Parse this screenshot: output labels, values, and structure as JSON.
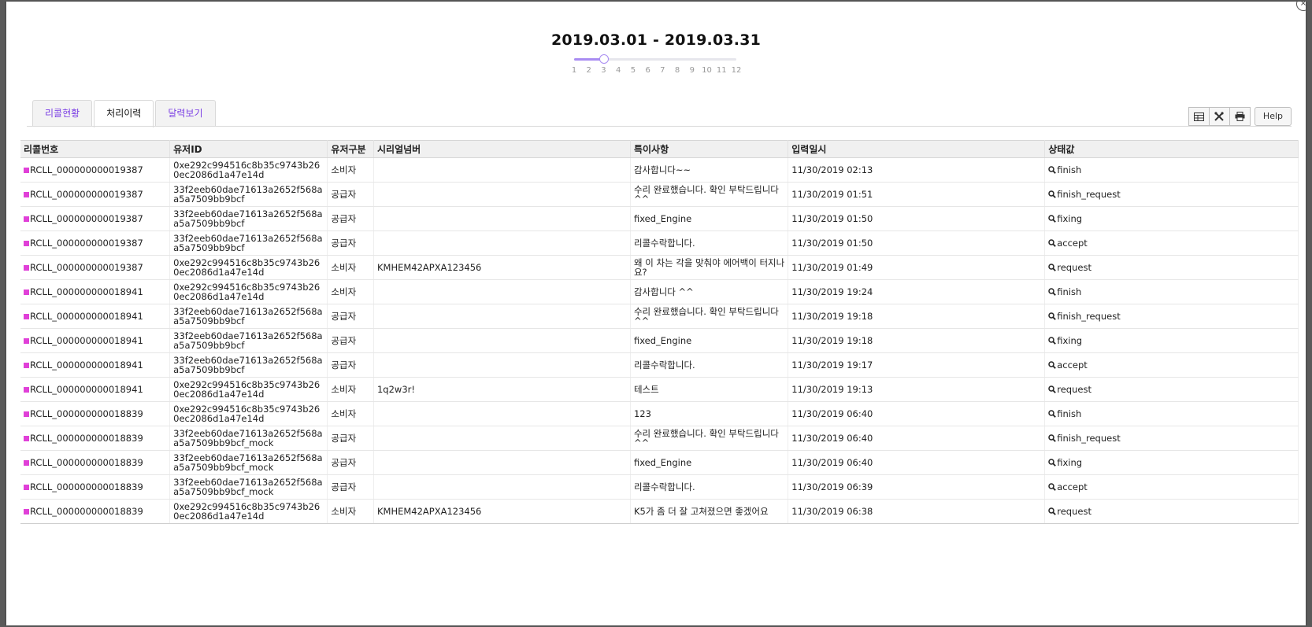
{
  "header": {
    "date_range": "2019.03.01 - 2019.03.31",
    "month_ticks": [
      "1",
      "2",
      "3",
      "4",
      "5",
      "6",
      "7",
      "8",
      "9",
      "10",
      "11",
      "12"
    ],
    "selected_month": 3
  },
  "tabs": [
    {
      "label": "리콜현황"
    },
    {
      "label": "처리이력"
    },
    {
      "label": "달력보기"
    }
  ],
  "toolbar": {
    "table_icon": "table-icon",
    "tools_icon": "tools-icon",
    "print_icon": "print-icon",
    "help_label": "Help"
  },
  "table": {
    "headers": [
      "리콜번호",
      "유저ID",
      "유저구분",
      "시리얼넘버",
      "특이사항",
      "입력일시",
      "상태값"
    ],
    "rows": [
      {
        "recall": "RCLL_000000000019387",
        "user": "0xe292c994516c8b35c9743b260ec2086d1a47e14d",
        "type": "소비자",
        "serial": "",
        "note": "감사합니다~~",
        "date": "11/30/2019 02:13",
        "status": "finish"
      },
      {
        "recall": "RCLL_000000000019387",
        "user": "33f2eeb60dae71613a2652f568aa5a7509bb9bcf",
        "type": "공급자",
        "serial": "",
        "note": "수리 완료했습니다. 확인 부탁드립니다 ^^",
        "date": "11/30/2019 01:51",
        "status": "finish_request"
      },
      {
        "recall": "RCLL_000000000019387",
        "user": "33f2eeb60dae71613a2652f568aa5a7509bb9bcf",
        "type": "공급자",
        "serial": "",
        "note": "fixed_Engine",
        "date": "11/30/2019 01:50",
        "status": "fixing"
      },
      {
        "recall": "RCLL_000000000019387",
        "user": "33f2eeb60dae71613a2652f568aa5a7509bb9bcf",
        "type": "공급자",
        "serial": "",
        "note": "리콜수락합니다.",
        "date": "11/30/2019 01:50",
        "status": "accept"
      },
      {
        "recall": "RCLL_000000000019387",
        "user": "0xe292c994516c8b35c9743b260ec2086d1a47e14d",
        "type": "소비자",
        "serial": "KMHEM42APXA123456",
        "note": "왜 이 차는 각을 맞춰야 에어백이 터지나요?",
        "date": "11/30/2019 01:49",
        "status": "request"
      },
      {
        "recall": "RCLL_000000000018941",
        "user": "0xe292c994516c8b35c9743b260ec2086d1a47e14d",
        "type": "소비자",
        "serial": "",
        "note": "감사합니다 ^^",
        "date": "11/30/2019 19:24",
        "status": "finish"
      },
      {
        "recall": "RCLL_000000000018941",
        "user": "33f2eeb60dae71613a2652f568aa5a7509bb9bcf",
        "type": "공급자",
        "serial": "",
        "note": "수리 완료했습니다. 확인 부탁드립니다 ^^",
        "date": "11/30/2019 19:18",
        "status": "finish_request"
      },
      {
        "recall": "RCLL_000000000018941",
        "user": "33f2eeb60dae71613a2652f568aa5a7509bb9bcf",
        "type": "공급자",
        "serial": "",
        "note": "fixed_Engine",
        "date": "11/30/2019 19:18",
        "status": "fixing"
      },
      {
        "recall": "RCLL_000000000018941",
        "user": "33f2eeb60dae71613a2652f568aa5a7509bb9bcf",
        "type": "공급자",
        "serial": "",
        "note": "리콜수락합니다.",
        "date": "11/30/2019 19:17",
        "status": "accept"
      },
      {
        "recall": "RCLL_000000000018941",
        "user": "0xe292c994516c8b35c9743b260ec2086d1a47e14d",
        "type": "소비자",
        "serial": "1q2w3r!",
        "note": "테스트",
        "date": "11/30/2019 19:13",
        "status": "request"
      },
      {
        "recall": "RCLL_000000000018839",
        "user": "0xe292c994516c8b35c9743b260ec2086d1a47e14d",
        "type": "소비자",
        "serial": "",
        "note": "123",
        "date": "11/30/2019 06:40",
        "status": "finish"
      },
      {
        "recall": "RCLL_000000000018839",
        "user": "33f2eeb60dae71613a2652f568aa5a7509bb9bcf_mock",
        "type": "공급자",
        "serial": "",
        "note": "수리 완료했습니다. 확인 부탁드립니다 ^^",
        "date": "11/30/2019 06:40",
        "status": "finish_request"
      },
      {
        "recall": "RCLL_000000000018839",
        "user": "33f2eeb60dae71613a2652f568aa5a7509bb9bcf_mock",
        "type": "공급자",
        "serial": "",
        "note": "fixed_Engine",
        "date": "11/30/2019 06:40",
        "status": "fixing"
      },
      {
        "recall": "RCLL_000000000018839",
        "user": "33f2eeb60dae71613a2652f568aa5a7509bb9bcf_mock",
        "type": "공급자",
        "serial": "",
        "note": "리콜수락합니다.",
        "date": "11/30/2019 06:39",
        "status": "accept"
      },
      {
        "recall": "RCLL_000000000018839",
        "user": "0xe292c994516c8b35c9743b260ec2086d1a47e14d",
        "type": "소비자",
        "serial": "KMHEM42APXA123456",
        "note": "K5가 좀 더 잘 고쳐졌으면 좋겠어요",
        "date": "11/30/2019 06:38",
        "status": "request"
      }
    ]
  },
  "colors": {
    "accent": "#a98cf2",
    "tab_link": "#7b3fe4",
    "recall_marker": "#e040d8"
  }
}
